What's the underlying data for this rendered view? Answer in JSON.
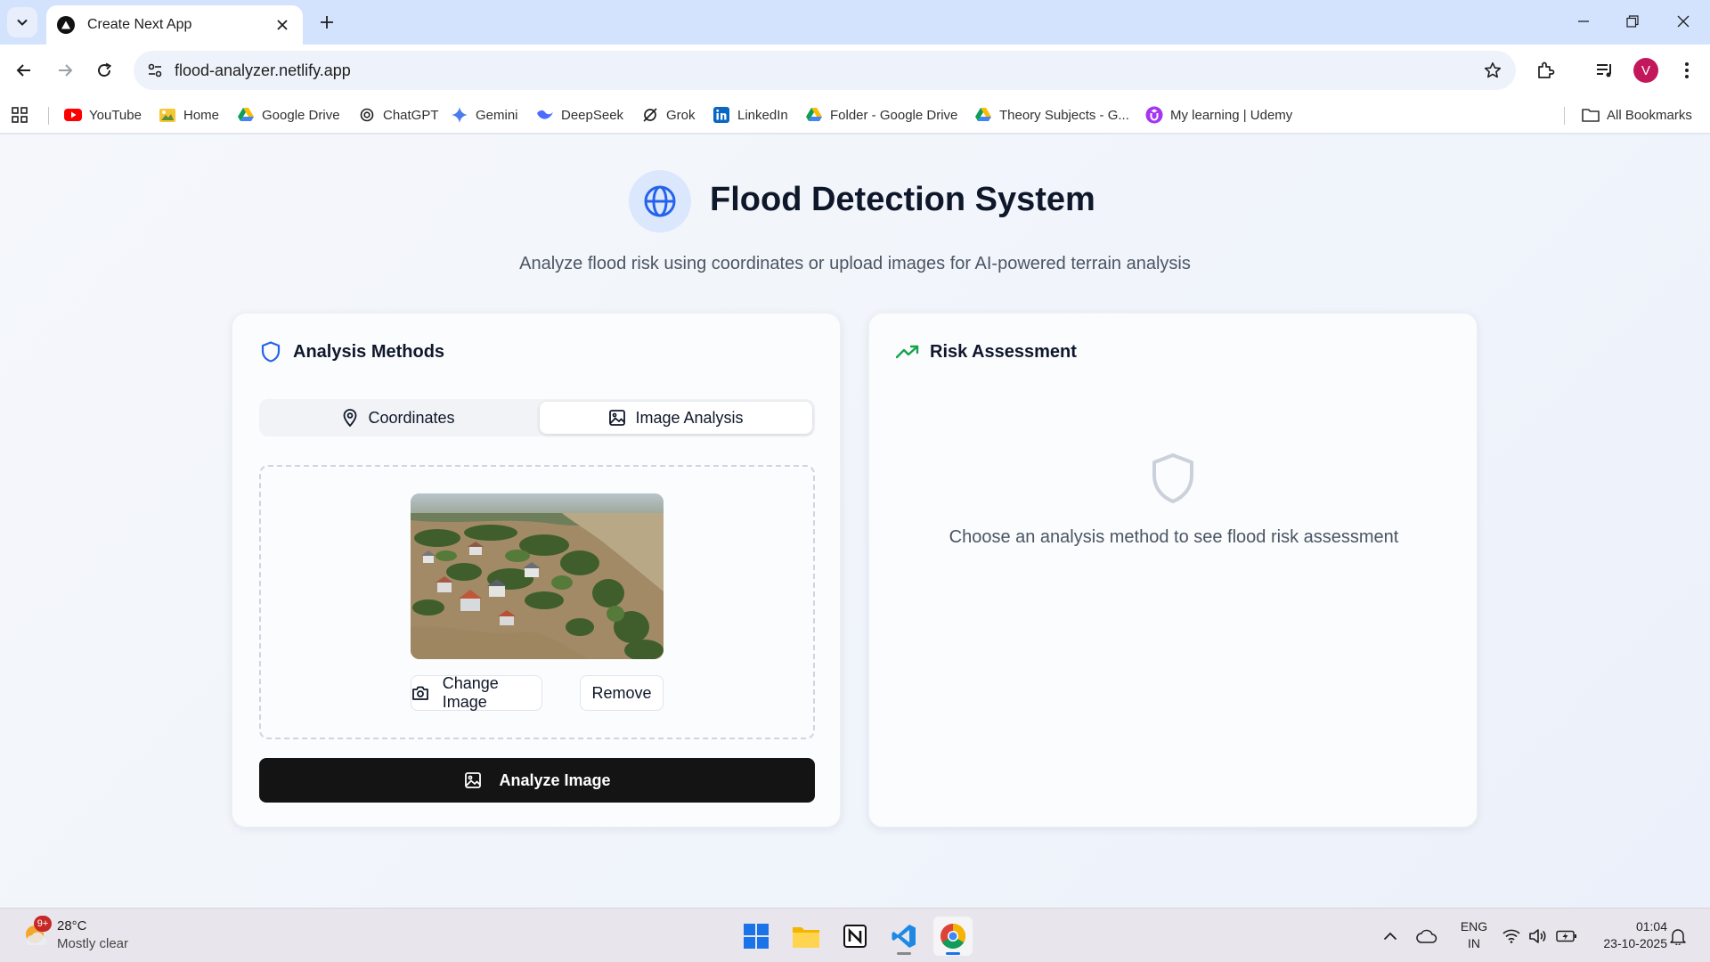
{
  "browser": {
    "tab_title": "Create Next App",
    "url": "flood-analyzer.netlify.app",
    "profile_initial": "V",
    "bookmarks": [
      {
        "label": "YouTube",
        "icon": "youtube-icon"
      },
      {
        "label": "Home",
        "icon": "home-icon"
      },
      {
        "label": "Google Drive",
        "icon": "google-drive-icon"
      },
      {
        "label": "ChatGPT",
        "icon": "chatgpt-icon"
      },
      {
        "label": "Gemini",
        "icon": "gemini-icon"
      },
      {
        "label": "DeepSeek",
        "icon": "deepseek-icon"
      },
      {
        "label": "Grok",
        "icon": "grok-icon"
      },
      {
        "label": "LinkedIn",
        "icon": "linkedin-icon"
      },
      {
        "label": "Folder - Google Drive",
        "icon": "google-drive-icon"
      },
      {
        "label": "Theory Subjects - G...",
        "icon": "google-drive-icon"
      },
      {
        "label": "My learning | Udemy",
        "icon": "udemy-icon"
      }
    ],
    "all_bookmarks_label": "All Bookmarks"
  },
  "page": {
    "title": "Flood Detection System",
    "subtitle": "Analyze flood risk using coordinates or upload images for AI-powered terrain analysis",
    "analysis": {
      "heading": "Analysis Methods",
      "tabs": [
        {
          "label": "Coordinates",
          "icon": "map-pin-icon",
          "active": false
        },
        {
          "label": "Image Analysis",
          "icon": "image-icon",
          "active": true
        }
      ],
      "preview_alt": "Uploaded aerial photo of a flooded village",
      "change_image_label": "Change Image",
      "remove_label": "Remove",
      "analyze_label": "Analyze Image"
    },
    "risk": {
      "heading": "Risk Assessment",
      "empty_text": "Choose an analysis method to see flood risk assessment"
    }
  },
  "taskbar": {
    "weather_badge": "9+",
    "weather_temp": "28°C",
    "weather_desc": "Mostly clear",
    "lang_line1": "ENG",
    "lang_line2": "IN",
    "time": "01:04",
    "date": "23-10-2025",
    "apps": [
      "start-icon",
      "file-explorer-icon",
      "notion-icon",
      "vscode-icon",
      "chrome-icon"
    ]
  },
  "colors": {
    "accent_blue": "#2563eb",
    "trend_green": "#16a34a",
    "primary_button": "#141414"
  }
}
